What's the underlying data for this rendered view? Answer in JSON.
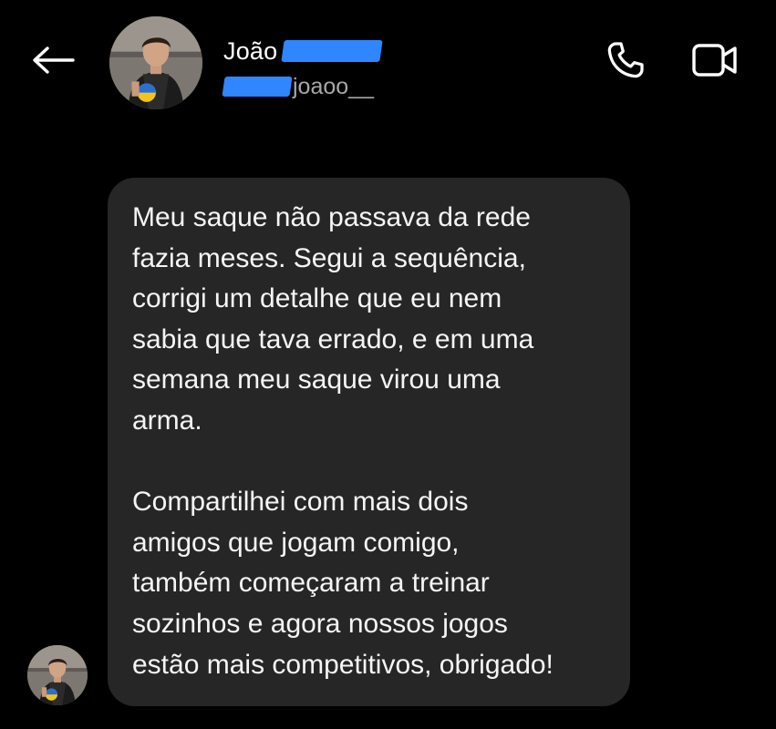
{
  "header": {
    "back_icon": "arrow-left-icon",
    "contact_name": "João",
    "username": "joaoo__",
    "phone_icon": "phone-icon",
    "video_icon": "video-camera-icon",
    "redaction_color": "#2f86ff"
  },
  "message": {
    "paragraph_1": [
      "Meu saque não passava da rede",
      "fazia meses. Segui a sequência,",
      "corrigi um detalhe que eu nem",
      "sabia que tava errado, e em uma",
      "semana meu saque virou uma",
      "arma."
    ],
    "paragraph_2": [
      "Compartilhei com mais dois",
      "amigos que jogam comigo,",
      "também começaram a treinar",
      "sozinhos e agora nossos jogos",
      "estão mais competitivos, obrigado!"
    ]
  },
  "colors": {
    "background": "#000000",
    "bubble": "#262626",
    "text": "#f5f5f5",
    "secondary_text": "#a8a8a8"
  }
}
